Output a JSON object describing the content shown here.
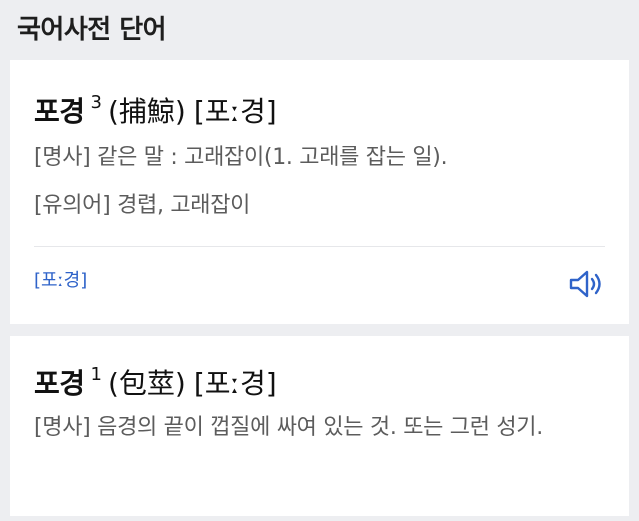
{
  "section_title": "국어사전 단어",
  "entries": [
    {
      "word": "포경",
      "homonym_number": "3",
      "hanja": "(捕鯨)",
      "pronunciation": "[포ː경]",
      "definitions": [
        "[명사] 같은 말 : 고래잡이(1. 고래를 잡는 일).",
        "[유의어] 경렵, 고래잡이"
      ],
      "pronunciation_link": "[포ː경]",
      "speaker_icon": "speaker-icon",
      "accent_color": "#2f63c9"
    },
    {
      "word": "포경",
      "homonym_number": "1",
      "hanja": "(包莖)",
      "pronunciation": "[포ː경]",
      "definitions": [
        "[명사] 음경의 끝이 껍질에 싸여 있는 것. 또는 그런 성기."
      ]
    }
  ]
}
